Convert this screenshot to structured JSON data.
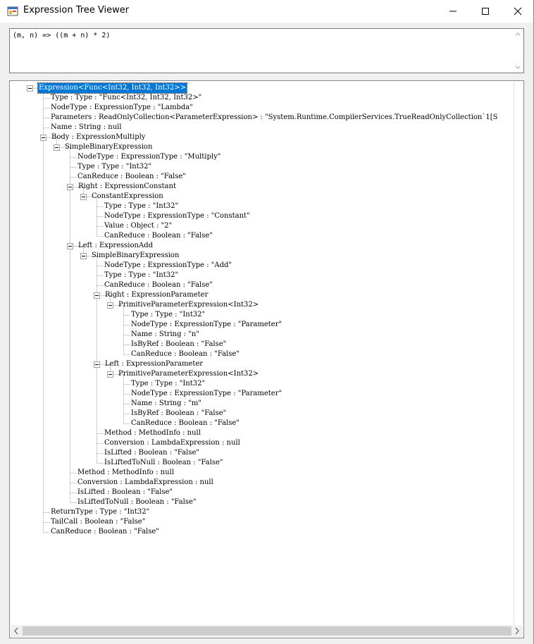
{
  "window": {
    "title": "Expression Tree Viewer",
    "buttons": [
      "minimize",
      "maximize",
      "close"
    ]
  },
  "expression_input": {
    "value": "(m, n) => ((m + n) * 2)"
  },
  "colors": {
    "selection": "#0078d7",
    "window_bg": "#f0f0f0",
    "tree_bg": "#ffffff"
  },
  "tree": {
    "nodes": [
      "Expression<Func<Int32, Int32, Int32>>",
      "Type : Type : \"Func<Int32, Int32, Int32>\"",
      "NodeType : ExpressionType : \"Lambda\"",
      "Parameters : ReadOnlyCollection<ParameterExpression> : \"System.Runtime.CompilerServices.TrueReadOnlyCollection`1[S",
      "Name : String : null",
      "Body : ExpressionMultiply",
      "SimpleBinaryExpression",
      "NodeType : ExpressionType : \"Multiply\"",
      "Type : Type : \"Int32\"",
      "CanReduce : Boolean : \"False\"",
      "Right : ExpressionConstant",
      "ConstantExpression",
      "Type : Type : \"Int32\"",
      "NodeType : ExpressionType : \"Constant\"",
      "Value : Object : \"2\"",
      "CanReduce : Boolean : \"False\"",
      "Left : ExpressionAdd",
      "SimpleBinaryExpression",
      "NodeType : ExpressionType : \"Add\"",
      "Type : Type : \"Int32\"",
      "CanReduce : Boolean : \"False\"",
      "Right : ExpressionParameter",
      "PrimitiveParameterExpression<Int32>",
      "Type : Type : \"Int32\"",
      "NodeType : ExpressionType : \"Parameter\"",
      "Name : String : \"n\"",
      "IsByRef : Boolean : \"False\"",
      "CanReduce : Boolean : \"False\"",
      "Left : ExpressionParameter",
      "PrimitiveParameterExpression<Int32>",
      "Type : Type : \"Int32\"",
      "NodeType : ExpressionType : \"Parameter\"",
      "Name : String : \"m\"",
      "IsByRef : Boolean : \"False\"",
      "CanReduce : Boolean : \"False\"",
      "Method : MethodInfo : null",
      "Conversion : LambdaExpression : null",
      "IsLifted : Boolean : \"False\"",
      "IsLiftedToNull : Boolean : \"False\"",
      "Method : MethodInfo : null",
      "Conversion : LambdaExpression : null",
      "IsLifted : Boolean : \"False\"",
      "IsLiftedToNull : Boolean : \"False\"",
      "ReturnType : Type : \"Int32\"",
      "TailCall : Boolean : \"False\"",
      "CanReduce : Boolean : \"False\""
    ],
    "depths": [
      0,
      1,
      1,
      1,
      1,
      1,
      2,
      3,
      3,
      3,
      3,
      4,
      5,
      5,
      5,
      5,
      3,
      4,
      5,
      5,
      5,
      5,
      6,
      7,
      7,
      7,
      7,
      7,
      5,
      6,
      7,
      7,
      7,
      7,
      7,
      5,
      5,
      5,
      5,
      3,
      3,
      3,
      3,
      1,
      1,
      1
    ],
    "expanded": [
      0,
      5,
      6,
      10,
      11,
      16,
      17,
      21,
      22,
      28,
      29
    ],
    "selected": 0
  }
}
